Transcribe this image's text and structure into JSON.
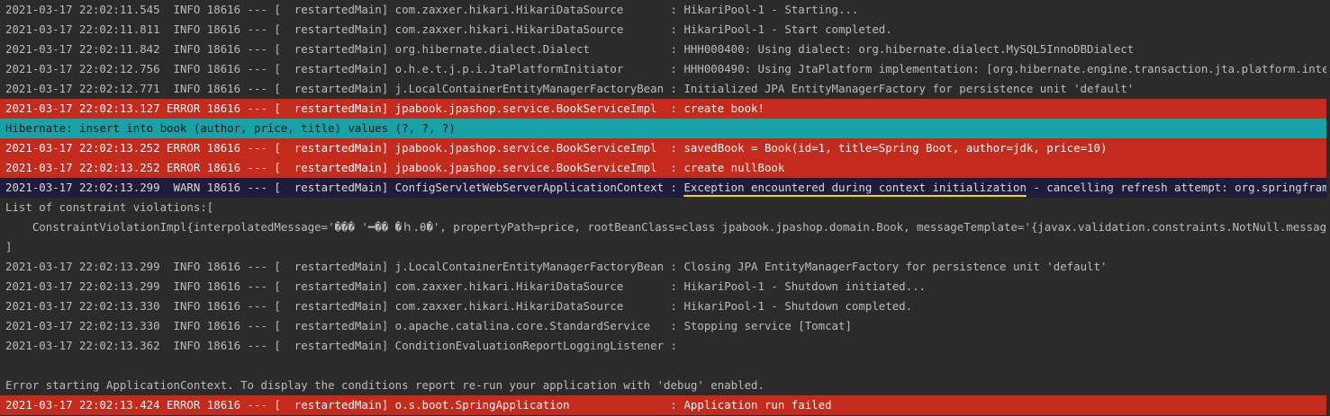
{
  "lines": [
    "2021-03-17 22:02:11.545  INFO 18616 --- [  restartedMain] com.zaxxer.hikari.HikariDataSource       : HikariPool-1 - Starting...",
    "2021-03-17 22:02:11.811  INFO 18616 --- [  restartedMain] com.zaxxer.hikari.HikariDataSource       : HikariPool-1 - Start completed.",
    "2021-03-17 22:02:11.842  INFO 18616 --- [  restartedMain] org.hibernate.dialect.Dialect            : HHH000400: Using dialect: org.hibernate.dialect.MySQL5InnoDBDialect",
    "2021-03-17 22:02:12.756  INFO 18616 --- [  restartedMain] o.h.e.t.j.p.i.JtaPlatformInitiator       : HHH000490: Using JtaPlatform implementation: [org.hibernate.engine.transaction.jta.platform.internal.NoJtaPla",
    "2021-03-17 22:02:12.771  INFO 18616 --- [  restartedMain] j.LocalContainerEntityManagerFactoryBean : Initialized JPA EntityManagerFactory for persistence unit 'default'",
    "2021-03-17 22:02:13.127 ERROR 18616 --- [  restartedMain] jpabook.jpashop.service.BookServiceImpl  : create book!",
    "Hibernate: insert into book (author, price, title) values (?, ?, ?)",
    "2021-03-17 22:02:13.252 ERROR 18616 --- [  restartedMain] jpabook.jpashop.service.BookServiceImpl  : savedBook = Book(id=1, title=Spring Boot, author=jdk, price=10)",
    "2021-03-17 22:02:13.252 ERROR 18616 --- [  restartedMain] jpabook.jpashop.service.BookServiceImpl  : create nullBook",
    "List of constraint violations:[",
    "    ConstraintViolationImpl{interpolatedMessage='��� '━�� �ｈ.θ�', propertyPath=price, rootBeanClass=class jpabook.jpashop.domain.Book, messageTemplate='{javax.validation.constraints.NotNull.message}'}",
    "]",
    "2021-03-17 22:02:13.299  INFO 18616 --- [  restartedMain] j.LocalContainerEntityManagerFactoryBean : Closing JPA EntityManagerFactory for persistence unit 'default'",
    "2021-03-17 22:02:13.299  INFO 18616 --- [  restartedMain] com.zaxxer.hikari.HikariDataSource       : HikariPool-1 - Shutdown initiated...",
    "2021-03-17 22:02:13.330  INFO 18616 --- [  restartedMain] com.zaxxer.hikari.HikariDataSource       : HikariPool-1 - Shutdown completed.",
    "2021-03-17 22:02:13.330  INFO 18616 --- [  restartedMain] o.apache.catalina.core.StandardService   : Stopping service [Tomcat]",
    "2021-03-17 22:02:13.362  INFO 18616 --- [  restartedMain] ConditionEvaluationReportLoggingListener : ",
    "",
    "Error starting ApplicationContext. To display the conditions report re-run your application with 'debug' enabled.",
    "2021-03-17 22:02:13.424 ERROR 18616 --- [  restartedMain] o.s.boot.SpringApplication               : Application run failed"
  ],
  "warn_line": {
    "prefix": "2021-03-17 22:02:13.299  WARN 18616 --- [  restartedMain] ConfigServletWebServerApplicationContext : ",
    "highlight": "Exception encountered during context initialization",
    "suffix": " - cancelling refresh attempt: org.springframework.beans.f"
  },
  "colors": {
    "background": "#2b2b2b",
    "error_bg": "#c42b1c",
    "sql_bg": "#17a2a8",
    "warn_bg": "#1f1c3b",
    "highlight_underline": "#f5d800"
  }
}
